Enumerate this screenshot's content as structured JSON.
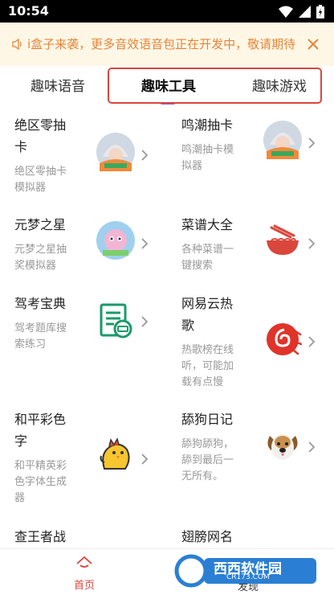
{
  "status_bar": {
    "time": "10:54",
    "icons": [
      "wifi-icon",
      "signal-icon",
      "battery-icon"
    ]
  },
  "notice": {
    "text": "i盒子来袭，更多音效语音包正在开发中，敬请期待",
    "color": "#e6853a"
  },
  "tabs": [
    {
      "label": "趣味语音"
    },
    {
      "label": "趣味工具"
    },
    {
      "label": "趣味游戏"
    }
  ],
  "items": [
    {
      "title_lines": [
        "绝区零抽",
        "卡"
      ],
      "desc_lines": [
        "绝区零抽卡",
        "模拟器"
      ],
      "icon": "anime-character-icon"
    },
    {
      "title_lines": [
        "鸣潮抽卡"
      ],
      "desc_lines": [
        "鸣潮抽卡模",
        "拟器"
      ],
      "icon": "anime-character-icon"
    },
    {
      "title_lines": [
        "元梦之星"
      ],
      "desc_lines": [
        "元梦之星抽",
        "奖模拟器"
      ],
      "icon": "game-character-icon"
    },
    {
      "title_lines": [
        "菜谱大全"
      ],
      "desc_lines": [
        "各种菜谱一",
        "键搜索"
      ],
      "icon": "noodle-bowl-icon"
    },
    {
      "title_lines": [
        "驾考宝典"
      ],
      "desc_lines": [
        "驾考题库搜",
        "索练习"
      ],
      "icon": "exam-document-icon"
    },
    {
      "title_lines": [
        "网易云热",
        "歌"
      ],
      "desc_lines": [
        "热歌榜在线",
        "听，可能加",
        "载有点慢"
      ],
      "icon": "netease-music-icon"
    },
    {
      "title_lines": [
        "和平彩色",
        "字"
      ],
      "desc_lines": [
        "和平精英彩",
        "色字体生成",
        "器"
      ],
      "icon": "chicken-icon"
    },
    {
      "title_lines": [
        "舔狗日记"
      ],
      "desc_lines": [
        "舔狗舔狗，",
        "舔到最后一",
        "无所有。"
      ],
      "icon": "dog-icon"
    },
    {
      "title_lines": [
        "查王者战"
      ],
      "desc_lines": [],
      "icon": ""
    },
    {
      "title_lines": [
        "翅膀网名"
      ],
      "desc_lines": [],
      "icon": ""
    }
  ],
  "bottom_nav": {
    "home_label": "首页",
    "right_label": "发现"
  },
  "watermark": {
    "brand": "西西软件园",
    "url": "CR173.COM"
  },
  "colors": {
    "accent_red": "#d9463c",
    "tab_indicator": "#7a6ee0",
    "notice_bg": "#fff7e6"
  }
}
